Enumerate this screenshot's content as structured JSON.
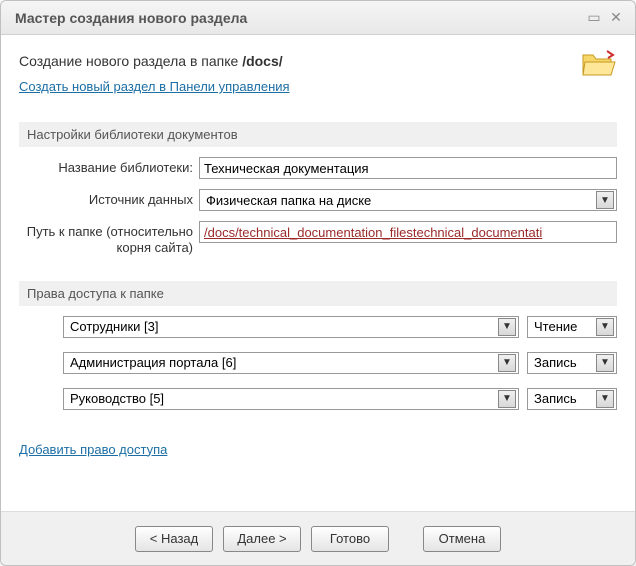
{
  "titlebar": {
    "title": "Мастер создания нового раздела"
  },
  "header": {
    "prefix": "Создание нового раздела в папке ",
    "path": "/docs/",
    "cp_link": "Создать новый раздел в Панели управления"
  },
  "sections": {
    "lib": "Настройки библиотеки документов",
    "access": "Права доступа к папке"
  },
  "form": {
    "lib_name_label": "Название библиотеки:",
    "lib_name_value": "Техническая документация",
    "source_label": "Источник данных",
    "source_value": "Физическая папка на диске",
    "path_label": "Путь к папке (относительно корня сайта)",
    "path_value": "/docs/technical_documentation_filestechnical_documentati"
  },
  "access": {
    "rows": [
      {
        "group": "Сотрудники [3]",
        "perm": "Чтение"
      },
      {
        "group": "Администрация портала [6]",
        "perm": "Запись"
      },
      {
        "group": "Руководство [5]",
        "perm": "Запись"
      }
    ],
    "add_link": "Добавить право доступа"
  },
  "buttons": {
    "back": "< Назад",
    "next": "Далее >",
    "finish": "Готово",
    "cancel": "Отмена"
  }
}
